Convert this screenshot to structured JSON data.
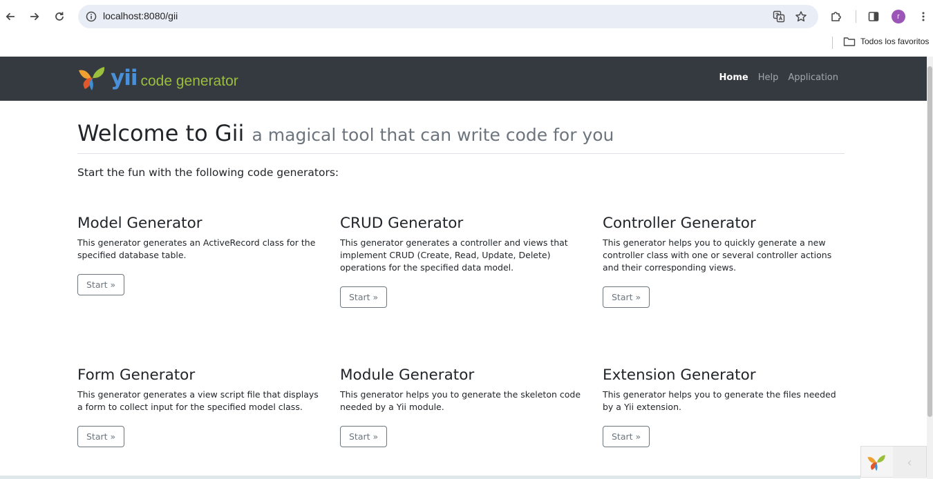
{
  "browser": {
    "url": "localhost:8080/gii",
    "bookmarks_folder": "Todos los favoritos",
    "profile_initial": "r"
  },
  "navbar": {
    "brand_yii": "yii",
    "brand_text": "code generator",
    "links": [
      {
        "label": "Home",
        "active": true
      },
      {
        "label": "Help",
        "active": false
      },
      {
        "label": "Application",
        "active": false
      }
    ]
  },
  "main": {
    "title": "Welcome to Gii",
    "subtitle": "a magical tool that can write code for you",
    "lead": "Start the fun with the following code generators:"
  },
  "generators": [
    {
      "title": "Model Generator",
      "description": "This generator generates an ActiveRecord class for the specified database table.",
      "button": "Start »"
    },
    {
      "title": "CRUD Generator",
      "description": "This generator generates a controller and views that implement CRUD (Create, Read, Update, Delete) operations for the specified data model.",
      "button": "Start »"
    },
    {
      "title": "Controller Generator",
      "description": "This generator helps you to quickly generate a new controller class with one or several controller actions and their corresponding views.",
      "button": "Start »"
    },
    {
      "title": "Form Generator",
      "description": "This generator generates a view script file that displays a form to collect input for the specified model class.",
      "button": "Start »"
    },
    {
      "title": "Module Generator",
      "description": "This generator helps you to generate the skeleton code needed by a Yii module.",
      "button": "Start »"
    },
    {
      "title": "Extension Generator",
      "description": "This generator helps you to generate the files needed by a Yii extension.",
      "button": "Start »"
    }
  ],
  "debug_toolbar": {
    "toggle": "‹"
  }
}
